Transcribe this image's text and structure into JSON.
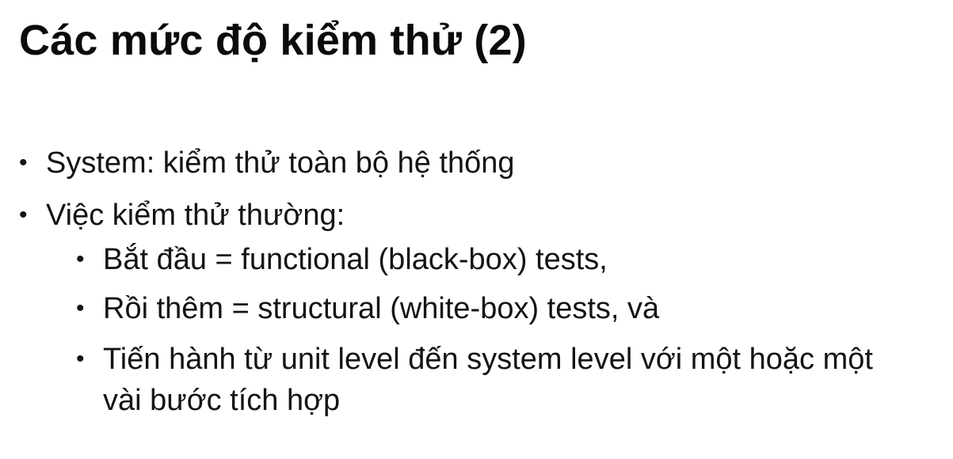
{
  "slide": {
    "title": "Các mức độ kiểm thử (2)",
    "bullets": [
      {
        "text": "System: kiểm thử toàn bộ hệ thống"
      },
      {
        "text": "Việc kiểm thử thường:",
        "sub_bullets": [
          {
            "text": "Bắt đầu = functional (black-box) tests,"
          },
          {
            "text": "Rồi thêm = structural (white-box) tests, và"
          },
          {
            "text": "Tiến hành từ unit level đến system level với một hoặc một vài bước tích hợp"
          }
        ]
      }
    ],
    "bullet_symbol": "•"
  }
}
